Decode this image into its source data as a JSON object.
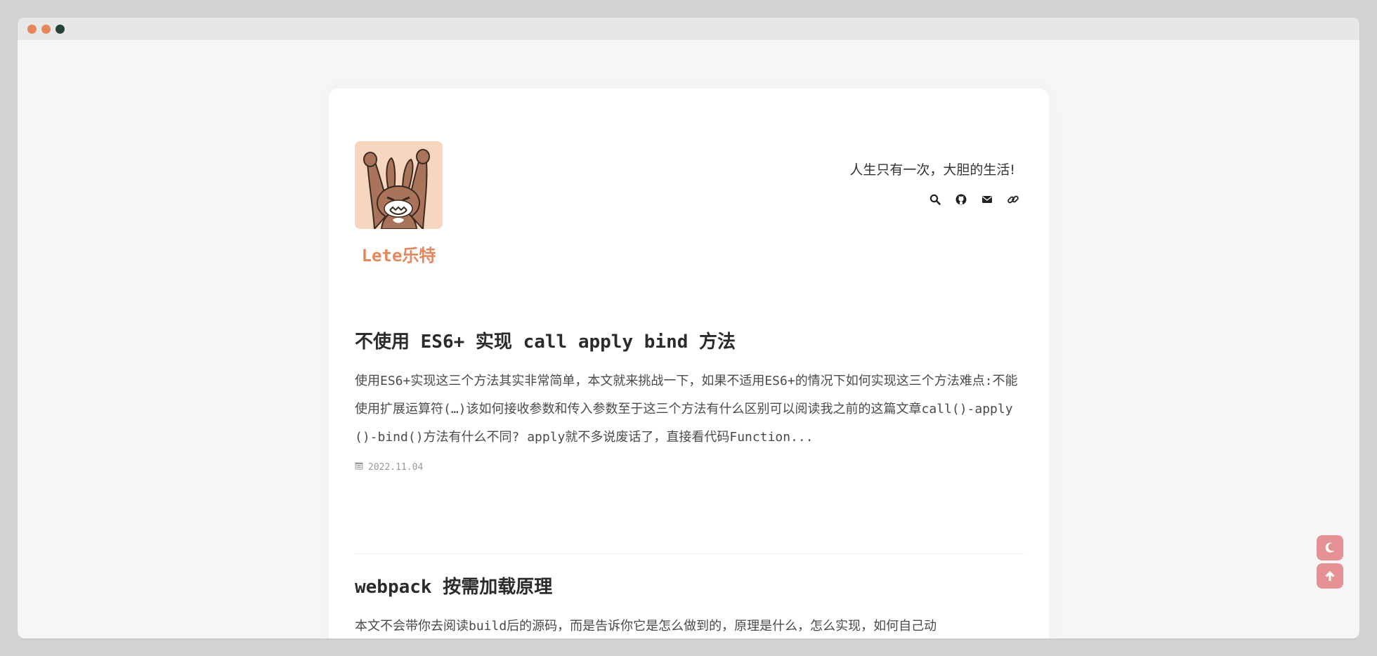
{
  "site": {
    "name": "Lete乐特",
    "motto": "人生只有一次，大胆的生活!"
  },
  "social": [
    {
      "icon": "search-icon"
    },
    {
      "icon": "github-icon"
    },
    {
      "icon": "mail-icon"
    },
    {
      "icon": "link-icon"
    }
  ],
  "posts": [
    {
      "title": "不使用 ES6+ 实现 call apply bind 方法",
      "excerpt": "使用ES6+实现这三个方法其实非常简单，本文就来挑战一下，如果不适用ES6+的情况下如何实现这三个方法难点:不能使用扩展运算符(…)该如何接收参数和传入参数至于这三个方法有什么区别可以阅读我之前的这篇文章call()-apply()-bind()方法有什么不同? apply就不多说废话了，直接看代码Function...",
      "date": "2022.11.04"
    },
    {
      "title": "webpack 按需加载原理",
      "excerpt": "本文不会带你去阅读build后的源码，而是告诉你它是怎么做到的，原理是什么，怎么实现，如何自己动"
    }
  ],
  "floating": {
    "dark_mode_icon": "moon-icon",
    "back_to_top_icon": "arrow-up-icon"
  },
  "colors": {
    "accent": "#e8855a",
    "fab": "#e59193",
    "window_dot_dark": "#254338"
  }
}
